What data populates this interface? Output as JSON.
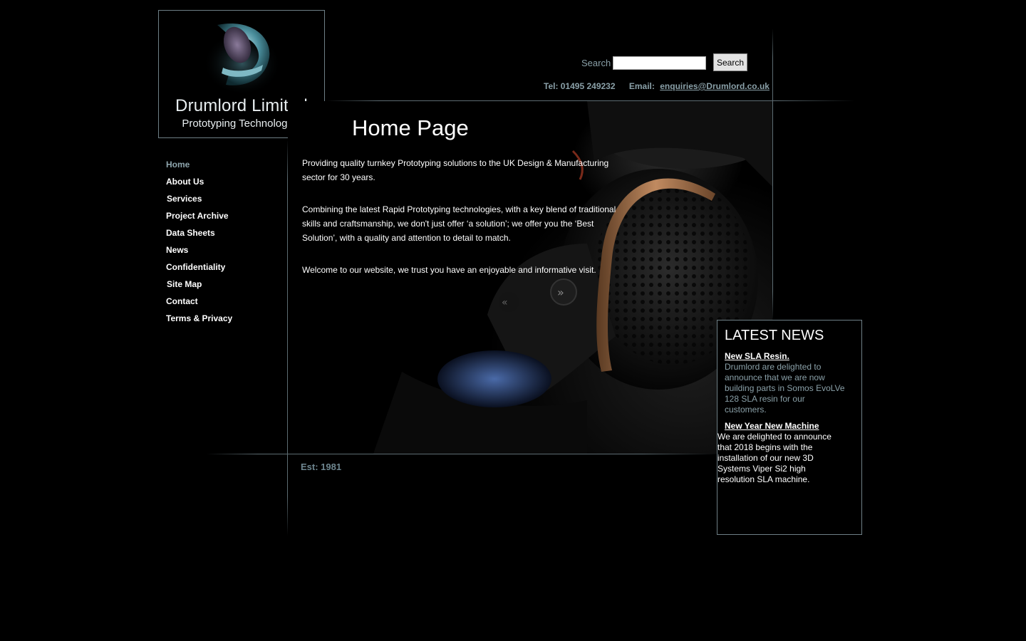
{
  "logo": {
    "title": "Drumlord Limited",
    "subtitle": "Prototyping Technologies"
  },
  "header": {
    "search_label": "Search",
    "search_value": "",
    "search_button": "Search",
    "tel": "Tel: 01495 249232",
    "email_label": "Email:",
    "email": "enquiries@Drumlord.co.uk"
  },
  "page_title": "Home Page",
  "nav": {
    "items": [
      {
        "label": "Home",
        "active": true
      },
      {
        "label": "About Us"
      },
      {
        "label": "Services"
      },
      {
        "label": "Project Archive"
      },
      {
        "label": "Data Sheets"
      },
      {
        "label": "News"
      },
      {
        "label": "Confidentiality"
      },
      {
        "label": "Site Map"
      },
      {
        "label": "Contact"
      },
      {
        "label": "Terms & Privacy"
      }
    ]
  },
  "content": {
    "para1": "Providing quality turnkey Prototyping solutions to the UK Design & Manufacturing sector for 30 years.",
    "para2": "Combining the latest Rapid Prototyping technologies, with a key blend of traditional skills and craftsmanship, we don't just offer ‘a solution’; we offer you the ‘Best Solution’, with a quality and attention to detail to match.",
    "para3": "Welcome to our website, we trust you have an enjoyable and informative visit."
  },
  "footer": {
    "est": "Est: 1981"
  },
  "news": {
    "heading": "LATEST NEWS",
    "items": [
      {
        "title": "New SLA Resin.",
        "body": "Drumlord are delighted to announce that we are now building parts in Somos EvoLVe 128 SLA resin for our customers."
      },
      {
        "title": "New Year New Machine",
        "body": "We are delighted to announce that 2018 begins with the installation of our new 3D Systems Viper Si2 high resolution SLA machine."
      }
    ]
  },
  "colors": {
    "background": "#000000",
    "accent": "#8aa0a8",
    "border": "#6e7f86"
  }
}
